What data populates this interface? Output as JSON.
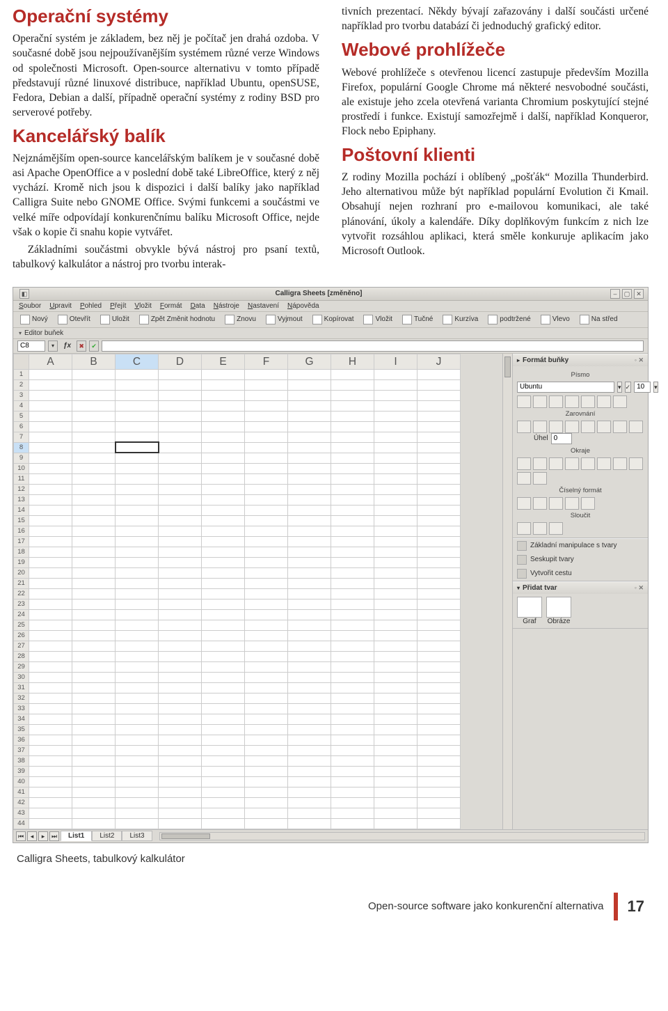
{
  "article": {
    "left": {
      "h1": "Operační systémy",
      "p1": "Operační systém je základem, bez něj je počítač jen drahá ozdoba. V současné době jsou nejpoužívanějším systémem různé verze Windows od společnosti Microsoft. Open-source alternativu v tomto případě představují různé linuxové distribuce, například Ubuntu, openSUSE, Fedora, Debian a další, případně operační systémy z rodiny BSD pro serverové potřeby.",
      "h2": "Kancelářský balík",
      "p2": "Nejznámějším open-source kancelářským balíkem je v současné době asi Apache OpenOffice a v poslední době také LibreOffice, který z něj vychází. Kromě nich jsou k dispozici i další balíky jako například Calligra Suite nebo GNOME Office. Svými funkcemi a součástmi ve velké míře odpovídají konkurenčnímu balíku Microsoft Office, nejde však o kopie či snahu kopie vytvářet.",
      "p3": "Základními součástmi obvykle bývá nástroj pro psaní textů, tabulkový kalkulátor a nástroj pro tvorbu interak-"
    },
    "right": {
      "p0": "tivních prezentací. Někdy bývají zařazovány i další součásti určené například pro tvorbu databází či jednoduchý grafický editor.",
      "h1": "Webové prohlížeče",
      "p1": "Webové prohlížeče s otevřenou licencí zastupuje především Mozilla Firefox, populární Google Chrome má některé nesvobodné součásti, ale existuje jeho zcela otevřená varianta Chromium poskytující stejné prostředí i funkce. Existují samozřejmě i další, například Konqueror, Flock nebo Epiphany.",
      "h2": "Poštovní klienti",
      "p2": "Z rodiny Mozilla pochází i oblíbený „pošťák“ Mozilla Thunderbird. Jeho alternativou může být například populární Evolution či Kmail. Obsahují nejen rozhraní pro e-mailovou komunikaci, ale také plánování, úkoly a kalendáře. Díky doplňkovým funkcím z nich lze vytvořit rozsáhlou aplikaci, která směle konkuruje aplikacím jako Microsoft Outlook."
    }
  },
  "screenshot": {
    "title": "Calligra Sheets [změněno]",
    "menus": [
      "Soubor",
      "Upravit",
      "Pohled",
      "Přejít",
      "Vložit",
      "Formát",
      "Data",
      "Nástroje",
      "Nastavení",
      "Nápověda"
    ],
    "toolbar": [
      "Nový",
      "Otevřít",
      "Uložit",
      "Zpět Změnit hodnotu",
      "Znovu",
      "Vyjmout",
      "Kopírovat",
      "Vložit",
      "Tučné",
      "Kurzíva",
      "podtržené",
      "Vlevo",
      "Na střed"
    ],
    "editorLabel": "Editor buňek",
    "cellRef": "C8",
    "columns": [
      "A",
      "B",
      "C",
      "D",
      "E",
      "F",
      "G",
      "H",
      "I",
      "J"
    ],
    "rows": 44,
    "selectedRow": 8,
    "selectedCol": "C",
    "tabs": [
      "List1",
      "List2",
      "List3"
    ],
    "activeTab": 0,
    "side": {
      "formatTitle": "Formát buňky",
      "fontLabel": "Písmo",
      "fontName": "Ubuntu",
      "fontSize": "10",
      "alignLabel": "Zarovnání",
      "angleLabel": "Úhel",
      "angleValue": "0",
      "borderLabel": "Okraje",
      "numberLabel": "Číselný formát",
      "mergeLabel": "Sloučit",
      "shapesTitle": "Základní manipulace s tvary",
      "groupTitle": "Seskupit tvary",
      "pathTitle": "Vytvořit cestu",
      "addShapeTitle": "Přidat tvar",
      "shapeGraf": "Graf",
      "shapeObraz": "Obráze"
    }
  },
  "caption": "Calligra Sheets, tabulkový kalkulátor",
  "footer": {
    "text": "Open-source software jako konkurenční alternativa",
    "page": "17"
  }
}
